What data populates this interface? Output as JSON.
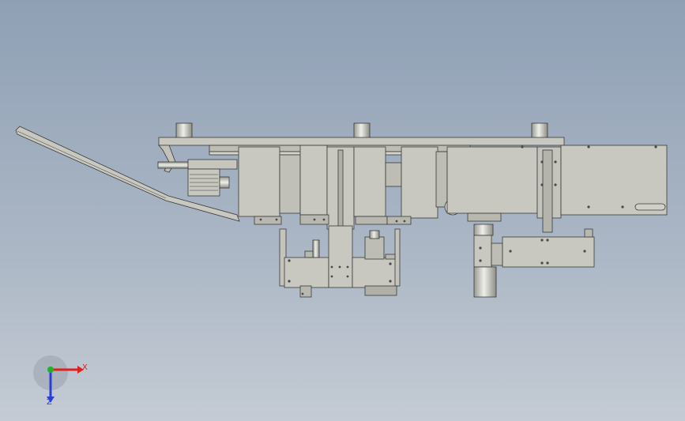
{
  "triad": {
    "x_label": "X",
    "z_label": "Z",
    "colors": {
      "x": "#e0201c",
      "y": "#22b02a",
      "z": "#2b3fd8"
    }
  },
  "palette": {
    "part_fill": "#c8c8c1",
    "part_fill_dark": "#b4b4ac",
    "edge": "#3a3a38",
    "background_top": "#8fa0b5",
    "background_bottom": "#c4cbd4"
  }
}
